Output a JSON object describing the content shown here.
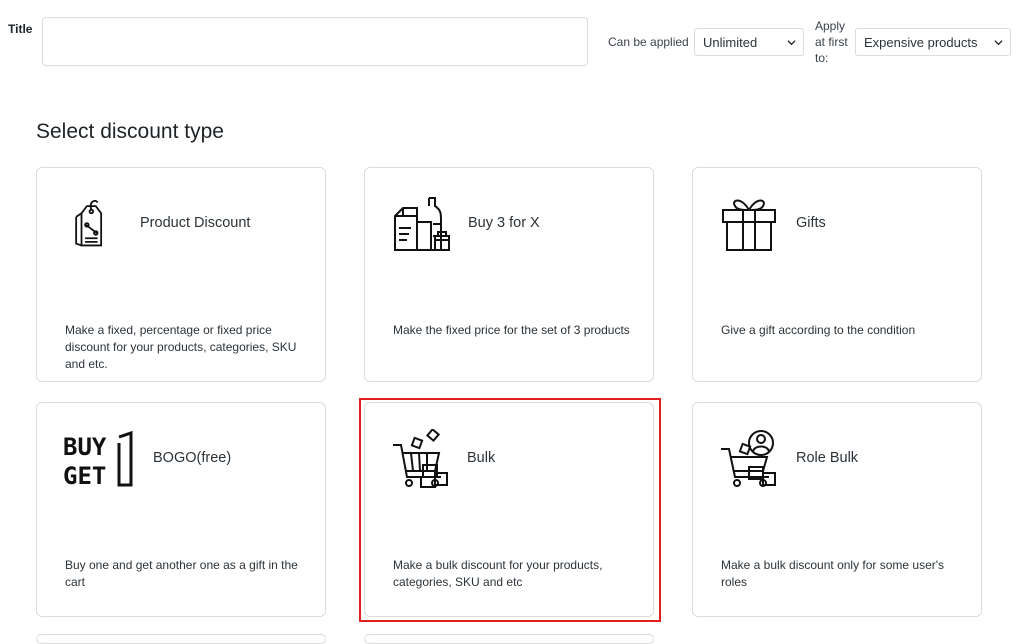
{
  "form": {
    "title_label": "Title",
    "title_value": "",
    "can_be_applied_label": "Can be applied",
    "can_be_applied_value": "Unlimited",
    "apply_at_first_label": "Apply at first to:",
    "apply_at_first_value": "Expensive products"
  },
  "section_title": "Select discount type",
  "cards": [
    {
      "name": "Product Discount",
      "icon": "price-tag-percent-icon",
      "desc": "Make a fixed, percentage or fixed price discount for your products, categories, SKU and etc."
    },
    {
      "name": "Buy 3 for X",
      "icon": "grocery-products-icon",
      "desc": "Make the fixed price for the set of 3 products"
    },
    {
      "name": "Gifts",
      "icon": "gift-box-icon",
      "desc": "Give a gift according to the condition"
    },
    {
      "name": "BOGO(free)",
      "icon": "buy-get-one-icon",
      "desc": "Buy one and get another one as a gift in the cart"
    },
    {
      "name": "Bulk",
      "icon": "bulk-cart-icon",
      "desc": "Make a bulk discount for your products, categories, SKU and etc"
    },
    {
      "name": "Role Bulk",
      "icon": "role-bulk-cart-icon",
      "desc": "Make a bulk discount only for some user's roles"
    }
  ],
  "colors": {
    "highlight": "#e02020",
    "border": "#dcdcde"
  }
}
